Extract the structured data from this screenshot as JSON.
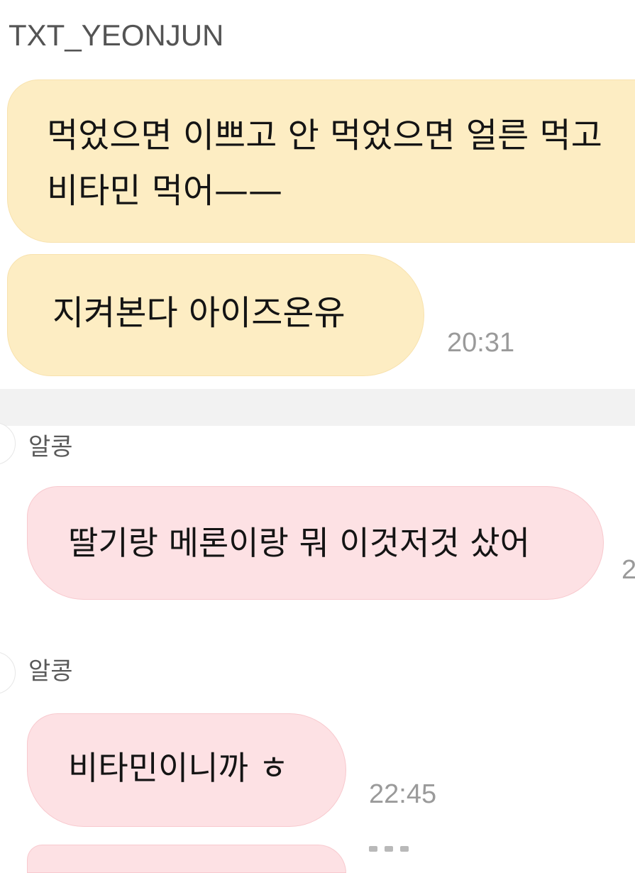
{
  "artist": {
    "name": "TXT_YEONJUN",
    "messages": [
      {
        "text": "먹었으면 이쁘고 안 먹었으면 얼른 먹고 비타민 먹어——"
      },
      {
        "text": "지켜본다 아이즈온유",
        "time": "20:31"
      }
    ]
  },
  "fans": [
    {
      "name": "알콩",
      "message": "딸기랑 메론이랑 뭐 이것저것 샀어",
      "time_fragment": "2"
    },
    {
      "name": "알콩",
      "message": "비타민이니까 ㅎ",
      "time": "22:45"
    }
  ],
  "colors": {
    "artist_bubble": "#fdedc3",
    "fan_bubble": "#fde1e4",
    "separator": "#f2f2f2",
    "timestamp": "#9a9a9a"
  }
}
